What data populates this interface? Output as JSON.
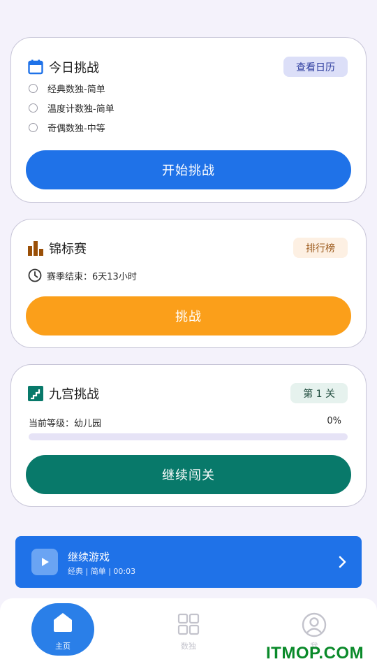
{
  "daily": {
    "title": "今日挑战",
    "calendar_button": "查看日历",
    "options": [
      "经典数独-简单",
      "温度计数独-简单",
      "奇偶数独-中等"
    ],
    "start_button": "开始挑战",
    "icon": "calendar-icon",
    "accent": "#1f72e8"
  },
  "tournament": {
    "title": "锦标赛",
    "leaderboard_button": "排行榜",
    "season_text": "赛季结束：6天13小时",
    "challenge_button": "挑战",
    "icon": "bar-chart-icon",
    "accent": "#fb9f1a"
  },
  "nine": {
    "title": "九宫挑战",
    "level_chip": "第 1 关",
    "level_text": "当前等级：幼儿园",
    "progress_text": "0%",
    "progress": 0,
    "continue_button": "继续闯关",
    "icon": "stairs-icon",
    "accent": "#08796a"
  },
  "resume": {
    "title": "继续游戏",
    "subtitle": "经典 | 简单 | 00:03",
    "icon": "play-icon",
    "accent": "#1f72e8"
  },
  "nav": {
    "items": [
      {
        "label": "主页",
        "icon": "home-icon",
        "active": true
      },
      {
        "label": "数独",
        "icon": "grid-icon",
        "active": false
      },
      {
        "label": "我",
        "icon": "profile-icon",
        "active": false
      }
    ]
  },
  "watermark": "ITMOP.COM"
}
